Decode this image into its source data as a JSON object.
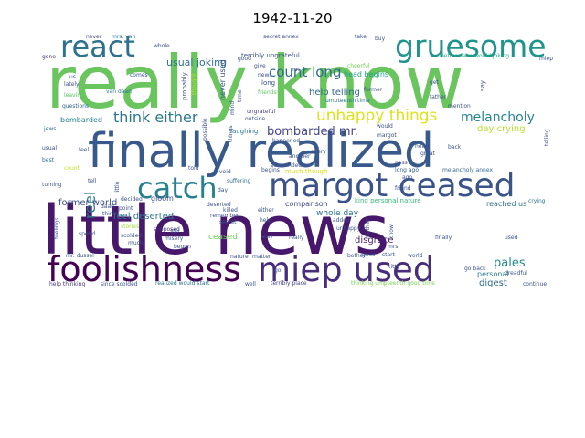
{
  "chart_data": {
    "type": "wordcloud",
    "title": "1942-11-20",
    "words": [
      {
        "text": "little news",
        "weight": 100,
        "color": "#46176a"
      },
      {
        "text": "really know",
        "weight": 96,
        "color": "#6ac55e"
      },
      {
        "text": "finally realized",
        "weight": 70,
        "color": "#38598c"
      },
      {
        "text": "foolishness",
        "weight": 52,
        "color": "#440154"
      },
      {
        "text": "miep used",
        "weight": 50,
        "color": "#472d7b"
      },
      {
        "text": "margot ceased",
        "weight": 52,
        "color": "#3a538b"
      },
      {
        "text": "catch",
        "weight": 45,
        "color": "#27808e"
      },
      {
        "text": "gruesome",
        "weight": 45,
        "color": "#1f948c"
      },
      {
        "text": "react",
        "weight": 42,
        "color": "#2c728e"
      },
      {
        "text": "unhappy things",
        "weight": 24,
        "color": "#dde318"
      },
      {
        "text": "think either",
        "weight": 21,
        "color": "#2a788e"
      },
      {
        "text": "count long",
        "weight": 20,
        "color": "#2f6c8e"
      },
      {
        "text": "melancholy",
        "weight": 20,
        "color": "#25848e"
      },
      {
        "text": "bombarded mr.",
        "weight": 18,
        "color": "#414487"
      },
      {
        "text": "reel",
        "weight": 22,
        "color": "#2a788e"
      },
      {
        "text": "pales",
        "weight": 18,
        "color": "#238a8d"
      },
      {
        "text": "usual joking",
        "weight": 15,
        "color": "#2d718e"
      },
      {
        "text": "feel deserted",
        "weight": 14,
        "color": "#2a788e"
      },
      {
        "text": "former world",
        "weight": 14,
        "color": "#3b528b"
      },
      {
        "text": "help telling",
        "weight": 13,
        "color": "#31688e"
      },
      {
        "text": "day crying",
        "weight": 13,
        "color": "#b5de2b"
      },
      {
        "text": "disgrace",
        "weight": 13,
        "color": "#481f70"
      },
      {
        "text": "digest",
        "weight": 13,
        "color": "#2f6c8e"
      },
      {
        "text": "whole day",
        "weight": 11,
        "color": "#2c728e"
      },
      {
        "text": "bombarded",
        "weight": 10,
        "color": "#277f8e"
      },
      {
        "text": "gloom",
        "weight": 10,
        "color": "#3e4c8a"
      },
      {
        "text": "ceased",
        "weight": 12,
        "color": "#6ece58"
      },
      {
        "text": "comparison",
        "weight": 10,
        "color": "#404688"
      },
      {
        "text": "personal",
        "weight": 10,
        "color": "#287d8e"
      },
      {
        "text": "never used",
        "weight": 10,
        "color": "#39568c"
      },
      {
        "text": "laughing",
        "weight": 8,
        "color": "#277e8e"
      },
      {
        "text": "much though",
        "weight": 9,
        "color": "#d8e219"
      },
      {
        "text": "reached us",
        "weight": 9,
        "color": "#2d708e"
      },
      {
        "text": "kind personal nature",
        "weight": 8,
        "color": "#35b779"
      },
      {
        "text": "melancholy annex",
        "weight": 8,
        "color": "#31688e"
      },
      {
        "text": "head begins",
        "weight": 9,
        "color": "#20a386"
      },
      {
        "text": "terribly ungrateful",
        "weight": 8,
        "color": "#3b528b"
      },
      {
        "text": "cheerful",
        "weight": 8,
        "color": "#73d056"
      },
      {
        "text": "long ago",
        "weight": 7,
        "color": "#355f8d"
      },
      {
        "text": "better daan would joking",
        "weight": 7,
        "color": "#27ad81"
      },
      {
        "text": "ungrateful",
        "weight": 7,
        "color": "#443a83"
      },
      {
        "text": "friends",
        "weight": 7,
        "color": "#5ec962"
      },
      {
        "text": "supposed",
        "weight": 7,
        "color": "#46337e"
      },
      {
        "text": "suffering",
        "weight": 7,
        "color": "#2e6e8e"
      },
      {
        "text": "crying",
        "weight": 7,
        "color": "#2a788e"
      },
      {
        "text": "realized would start",
        "weight": 7,
        "color": "#2c728e"
      },
      {
        "text": "thinking umpteenth good time",
        "weight": 7,
        "color": "#7ad151"
      },
      {
        "text": "terribly place",
        "weight": 7,
        "color": "#414487"
      },
      {
        "text": "help thinking",
        "weight": 6,
        "color": "#453882"
      },
      {
        "text": "since scolded",
        "weight": 6,
        "color": "#3b528b"
      },
      {
        "text": "umpteenth time",
        "weight": 6,
        "color": "#2c728e"
      },
      {
        "text": "secret annex",
        "weight": 6,
        "color": "#3e4989"
      },
      {
        "text": "mrs. van",
        "weight": 6,
        "color": "#2a768e"
      },
      {
        "text": "never",
        "weight": 6,
        "color": "#404688"
      },
      {
        "text": "whole",
        "weight": 6,
        "color": "#3b528b"
      },
      {
        "text": "lately",
        "weight": 6,
        "color": "#3b528b"
      },
      {
        "text": "leaving",
        "weight": 6,
        "color": "#52c569"
      },
      {
        "text": "questions",
        "weight": 6,
        "color": "#31688e"
      },
      {
        "text": "van daan",
        "weight": 6,
        "color": "#2a788e"
      },
      {
        "text": "comes",
        "weight": 6,
        "color": "#3b528b"
      },
      {
        "text": "probably",
        "weight": 7,
        "color": "#3b528b"
      },
      {
        "text": "thought",
        "weight": 6,
        "color": "#b5de2b"
      },
      {
        "text": "gone",
        "weight": 6,
        "color": "#46327e"
      },
      {
        "text": "us",
        "weight": 6,
        "color": "#3b528b"
      },
      {
        "text": "feel",
        "weight": 7,
        "color": "#39568c"
      },
      {
        "text": "usual",
        "weight": 7,
        "color": "#3e4a89"
      },
      {
        "text": "jews",
        "weight": 6,
        "color": "#2c728e"
      },
      {
        "text": "best",
        "weight": 6,
        "color": "#2c728e"
      },
      {
        "text": "count",
        "weight": 6,
        "color": "#c2df23"
      },
      {
        "text": "turning",
        "weight": 6,
        "color": "#3b528b"
      },
      {
        "text": "feelings",
        "weight": 6,
        "color": "#3b528b"
      },
      {
        "text": "spend",
        "weight": 6,
        "color": "#3b528b"
      },
      {
        "text": "stories",
        "weight": 6,
        "color": "#a2da37"
      },
      {
        "text": "scolded",
        "weight": 6,
        "color": "#3b528b"
      },
      {
        "text": "much",
        "weight": 6,
        "color": "#3b528b"
      },
      {
        "text": "misery",
        "weight": 6,
        "color": "#3b528b"
      },
      {
        "text": "still",
        "weight": 6,
        "color": "#3b528b"
      },
      {
        "text": "begun",
        "weight": 6,
        "color": "#3b528b"
      },
      {
        "text": "decided",
        "weight": 6,
        "color": "#3b528b"
      },
      {
        "text": "point",
        "weight": 6,
        "color": "#3b528b"
      },
      {
        "text": "think",
        "weight": 6,
        "color": "#3b528b"
      },
      {
        "text": "daan",
        "weight": 6,
        "color": "#3b528b"
      },
      {
        "text": "cry",
        "weight": 6,
        "color": "#3b528b"
      },
      {
        "text": "possible",
        "weight": 6,
        "color": "#3b528b"
      },
      {
        "text": "told",
        "weight": 6,
        "color": "#3b528b"
      },
      {
        "text": "void",
        "weight": 6,
        "color": "#3b528b"
      },
      {
        "text": "day",
        "weight": 6,
        "color": "#3b528b"
      },
      {
        "text": "secret",
        "weight": 6,
        "color": "#3b528b"
      },
      {
        "text": "remember",
        "weight": 6,
        "color": "#3b528b"
      },
      {
        "text": "deserted",
        "weight": 6,
        "color": "#3b528b"
      },
      {
        "text": "killed",
        "weight": 6,
        "color": "#3b528b"
      },
      {
        "text": "help",
        "weight": 6,
        "color": "#3b528b"
      },
      {
        "text": "stay",
        "weight": 6,
        "color": "#3b528b"
      },
      {
        "text": "really",
        "weight": 6,
        "color": "#3b528b"
      },
      {
        "text": "either",
        "weight": 6,
        "color": "#3b528b"
      },
      {
        "text": "surrounded",
        "weight": 6,
        "color": "#3b528b"
      },
      {
        "text": "begins",
        "weight": 6,
        "color": "#3b528b"
      },
      {
        "text": "another",
        "weight": 6,
        "color": "#3b528b"
      },
      {
        "text": "every",
        "weight": 6,
        "color": "#3b528b"
      },
      {
        "text": "happened",
        "weight": 6,
        "color": "#3b528b"
      },
      {
        "text": "outside",
        "weight": 6,
        "color": "#3b528b"
      },
      {
        "text": "news",
        "weight": 6,
        "color": "#3b528b"
      },
      {
        "text": "give",
        "weight": 6,
        "color": "#3b528b"
      },
      {
        "text": "mr.",
        "weight": 6,
        "color": "#3b528b"
      },
      {
        "text": "long",
        "weight": 7,
        "color": "#3b528b"
      },
      {
        "text": "take",
        "weight": 6,
        "color": "#3b528b"
      },
      {
        "text": "former",
        "weight": 6,
        "color": "#3b528b"
      },
      {
        "text": "would",
        "weight": 6,
        "color": "#3b528b"
      },
      {
        "text": "margot",
        "weight": 6,
        "color": "#3b528b"
      },
      {
        "text": "head",
        "weight": 6,
        "color": "#3b528b"
      },
      {
        "text": "great",
        "weight": 6,
        "color": "#3b528b"
      },
      {
        "text": "back",
        "weight": 6,
        "color": "#3b528b"
      },
      {
        "text": "father",
        "weight": 6,
        "color": "#3b528b"
      },
      {
        "text": "mention",
        "weight": 6,
        "color": "#3b528b"
      },
      {
        "text": "telling",
        "weight": 6,
        "color": "#3b528b"
      },
      {
        "text": "pass",
        "weight": 6,
        "color": "#3b528b"
      },
      {
        "text": "friend",
        "weight": 6,
        "color": "#3b528b"
      },
      {
        "text": "get",
        "weight": 6,
        "color": "#3b528b"
      },
      {
        "text": "say",
        "weight": 6,
        "color": "#3b528b"
      },
      {
        "text": "miep",
        "weight": 6,
        "color": "#3b528b"
      },
      {
        "text": "buy",
        "weight": 6,
        "color": "#3b528b"
      },
      {
        "text": "added",
        "weight": 6,
        "color": "#3b528b"
      },
      {
        "text": "unhappy",
        "weight": 6,
        "color": "#3b528b"
      },
      {
        "text": "bother",
        "weight": 6,
        "color": "#3b528b"
      },
      {
        "text": "mrs.",
        "weight": 6,
        "color": "#3b528b"
      },
      {
        "text": "mother",
        "weight": 6,
        "color": "#3b528b"
      },
      {
        "text": "know",
        "weight": 6,
        "color": "#3b528b"
      },
      {
        "text": "kitty",
        "weight": 6,
        "color": "#3b528b"
      },
      {
        "text": "finally",
        "weight": 6,
        "color": "#3b528b"
      },
      {
        "text": "used",
        "weight": 6,
        "color": "#3b528b"
      },
      {
        "text": "go back",
        "weight": 6,
        "color": "#3b528b"
      },
      {
        "text": "dreadful",
        "weight": 6,
        "color": "#3b528b"
      },
      {
        "text": "continue",
        "weight": 6,
        "color": "#3b528b"
      },
      {
        "text": "world",
        "weight": 6,
        "color": "#3b528b"
      },
      {
        "text": "start",
        "weight": 6,
        "color": "#3b528b"
      },
      {
        "text": "goes",
        "weight": 6,
        "color": "#3b528b"
      },
      {
        "text": "mr. dussel",
        "weight": 6,
        "color": "#3b528b"
      },
      {
        "text": "nature",
        "weight": 6,
        "color": "#3b528b"
      },
      {
        "text": "matter",
        "weight": 6,
        "color": "#3b528b"
      },
      {
        "text": "little",
        "weight": 6,
        "color": "#3b528b"
      },
      {
        "text": "tell",
        "weight": 6,
        "color": "#3b528b"
      },
      {
        "text": "good",
        "weight": 6,
        "color": "#3b528b"
      },
      {
        "text": "time",
        "weight": 6,
        "color": "#3b528b"
      },
      {
        "text": "mind",
        "weight": 6,
        "color": "#3b528b"
      },
      {
        "text": "things",
        "weight": 6,
        "color": "#3b528b"
      },
      {
        "text": "go",
        "weight": 6,
        "color": "#3b528b"
      },
      {
        "text": "well",
        "weight": 6,
        "color": "#3b528b"
      },
      {
        "text": "ago",
        "weight": 6,
        "color": "#3b528b"
      }
    ]
  }
}
